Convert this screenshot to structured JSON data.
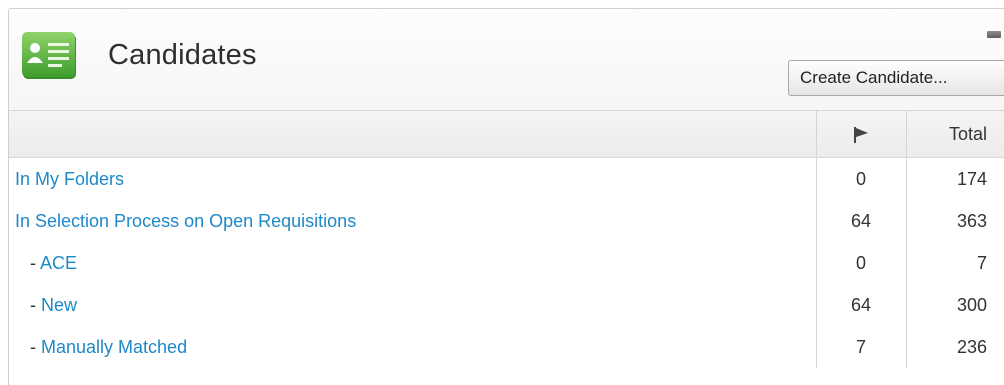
{
  "widget": {
    "title": "Candidates",
    "create_button_label": "Create Candidate..."
  },
  "table": {
    "header": {
      "flag_icon": "flag-icon",
      "total_label": "Total"
    },
    "rows": [
      {
        "prefix": "",
        "label": "In My Folders",
        "flagged": "0",
        "total": "174"
      },
      {
        "prefix": "",
        "label": "In Selection Process on Open Requisitions",
        "flagged": "64",
        "total": "363"
      },
      {
        "prefix": "- ",
        "label": "ACE",
        "flagged": "0",
        "total": "7"
      },
      {
        "prefix": "- ",
        "label": "New",
        "flagged": "64",
        "total": "300"
      },
      {
        "prefix": "- ",
        "label": "Manually Matched",
        "flagged": "7",
        "total": "236"
      }
    ]
  },
  "colors": {
    "link": "#1e88c9",
    "icon_green": "#5cb85c"
  }
}
